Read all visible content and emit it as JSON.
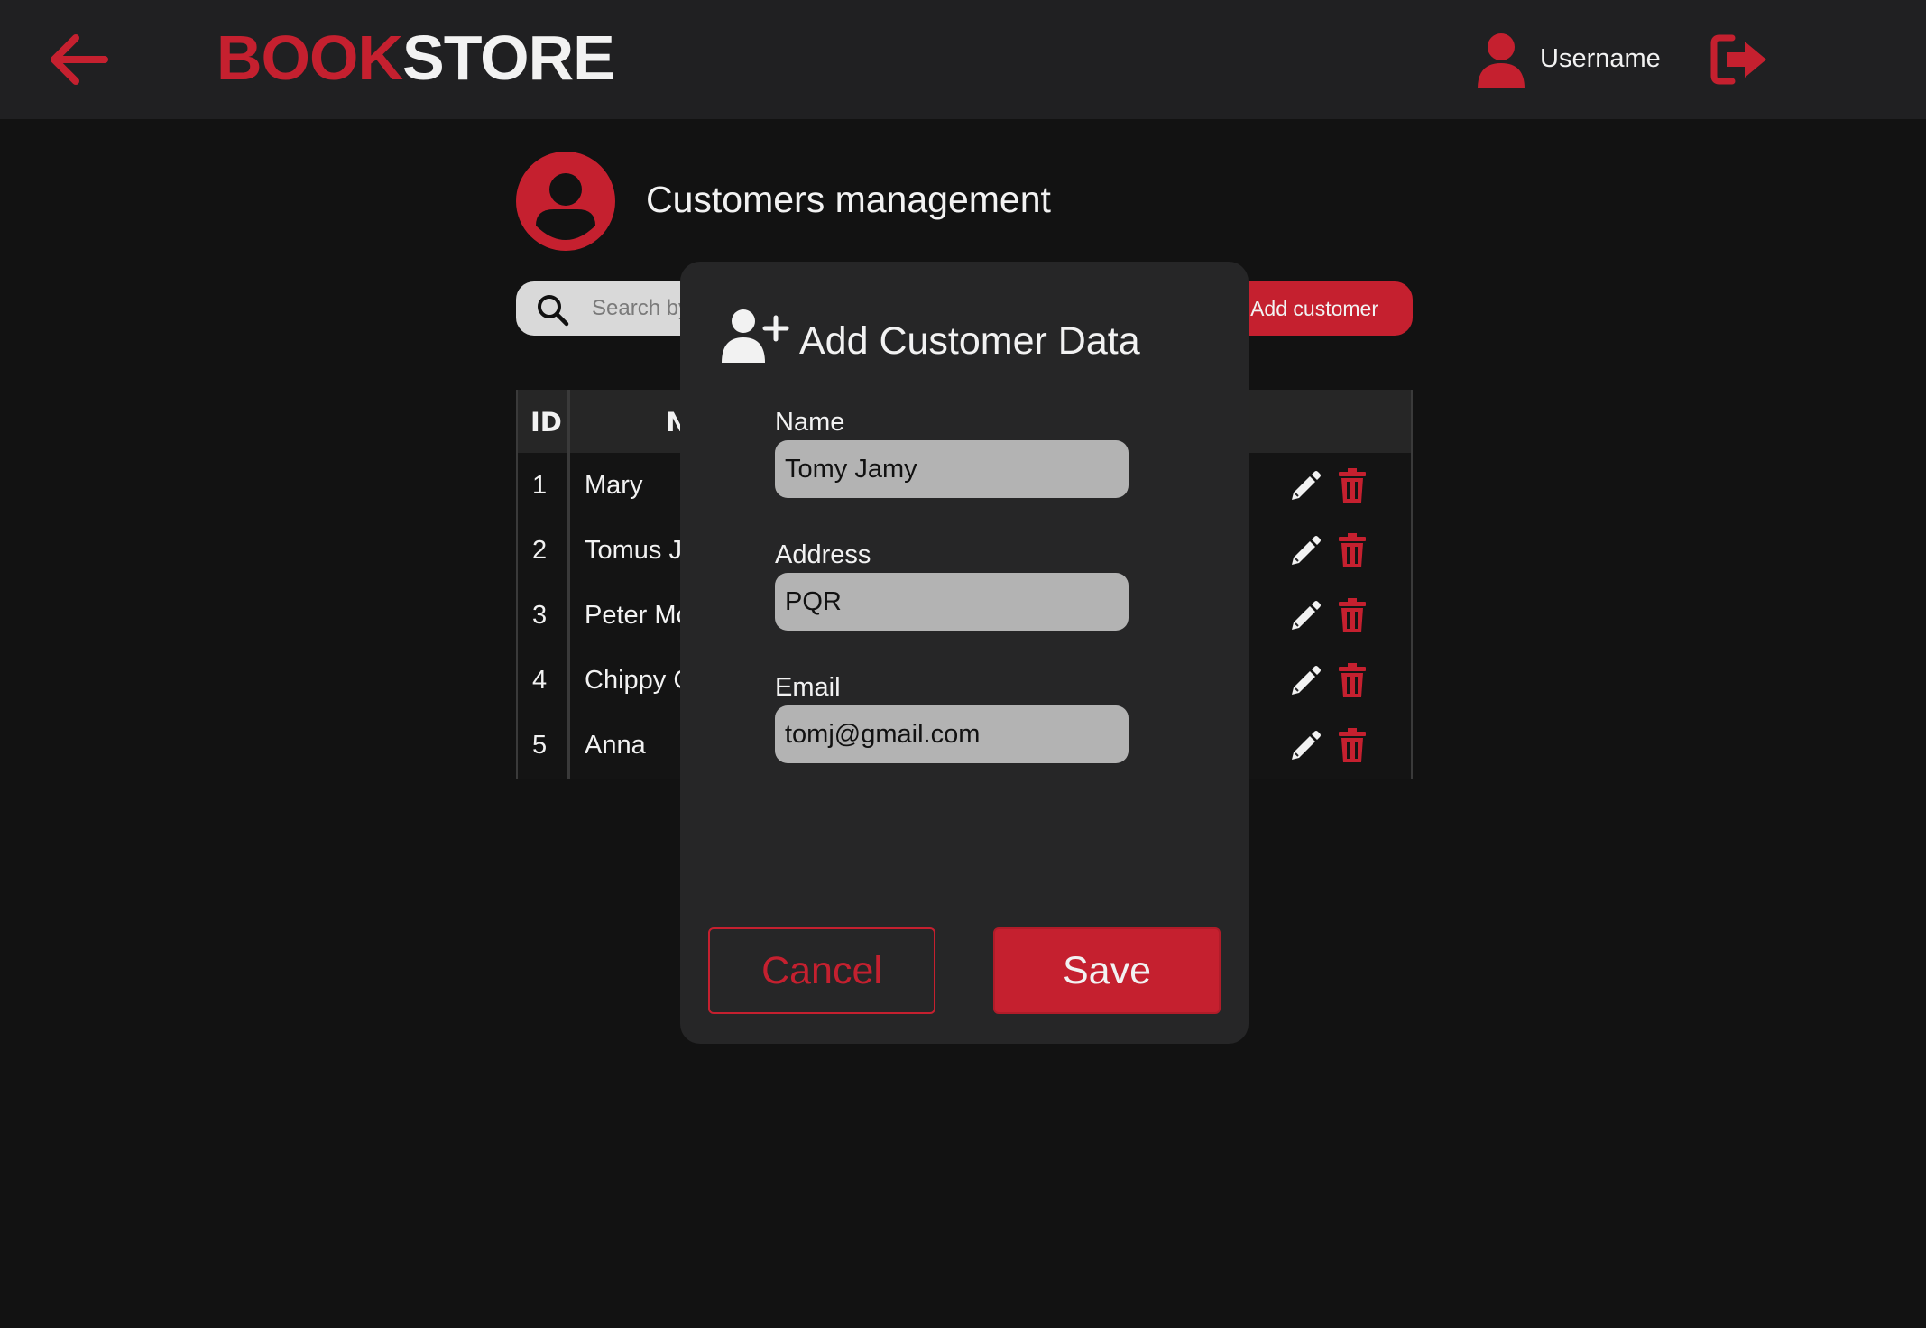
{
  "header": {
    "logo_part1": "BOOK",
    "logo_part2": "STORE",
    "username": "Username"
  },
  "page": {
    "title": "Customers management"
  },
  "toolbar": {
    "search_placeholder": "Search by",
    "add_label": "Add customer"
  },
  "table": {
    "columns": {
      "id": "ID",
      "name_partial": "N"
    },
    "rows": [
      {
        "id": "1",
        "name": "Mary"
      },
      {
        "id": "2",
        "name": "Tomus J."
      },
      {
        "id": "3",
        "name": "Peter Mc"
      },
      {
        "id": "4",
        "name": "Chippy C"
      },
      {
        "id": "5",
        "name": "Anna"
      }
    ]
  },
  "modal": {
    "title": "Add Customer Data",
    "name_label": "Name",
    "name_value": "Tomy Jamy",
    "address_label": "Address",
    "address_value": "PQR",
    "email_label": "Email",
    "email_value": "tomj@gmail.com",
    "cancel_label": "Cancel",
    "save_label": "Save"
  },
  "colors": {
    "accent": "#c5202f",
    "background": "#121212",
    "topbar": "#202022",
    "modal": "#262627",
    "input": "#b3b3b3"
  },
  "icons": {
    "back": "arrow-left-icon",
    "user": "user-icon",
    "logout": "logout-icon",
    "search": "search-icon",
    "add_user": "user-plus-icon",
    "edit": "pencil-icon",
    "delete": "trash-icon"
  }
}
